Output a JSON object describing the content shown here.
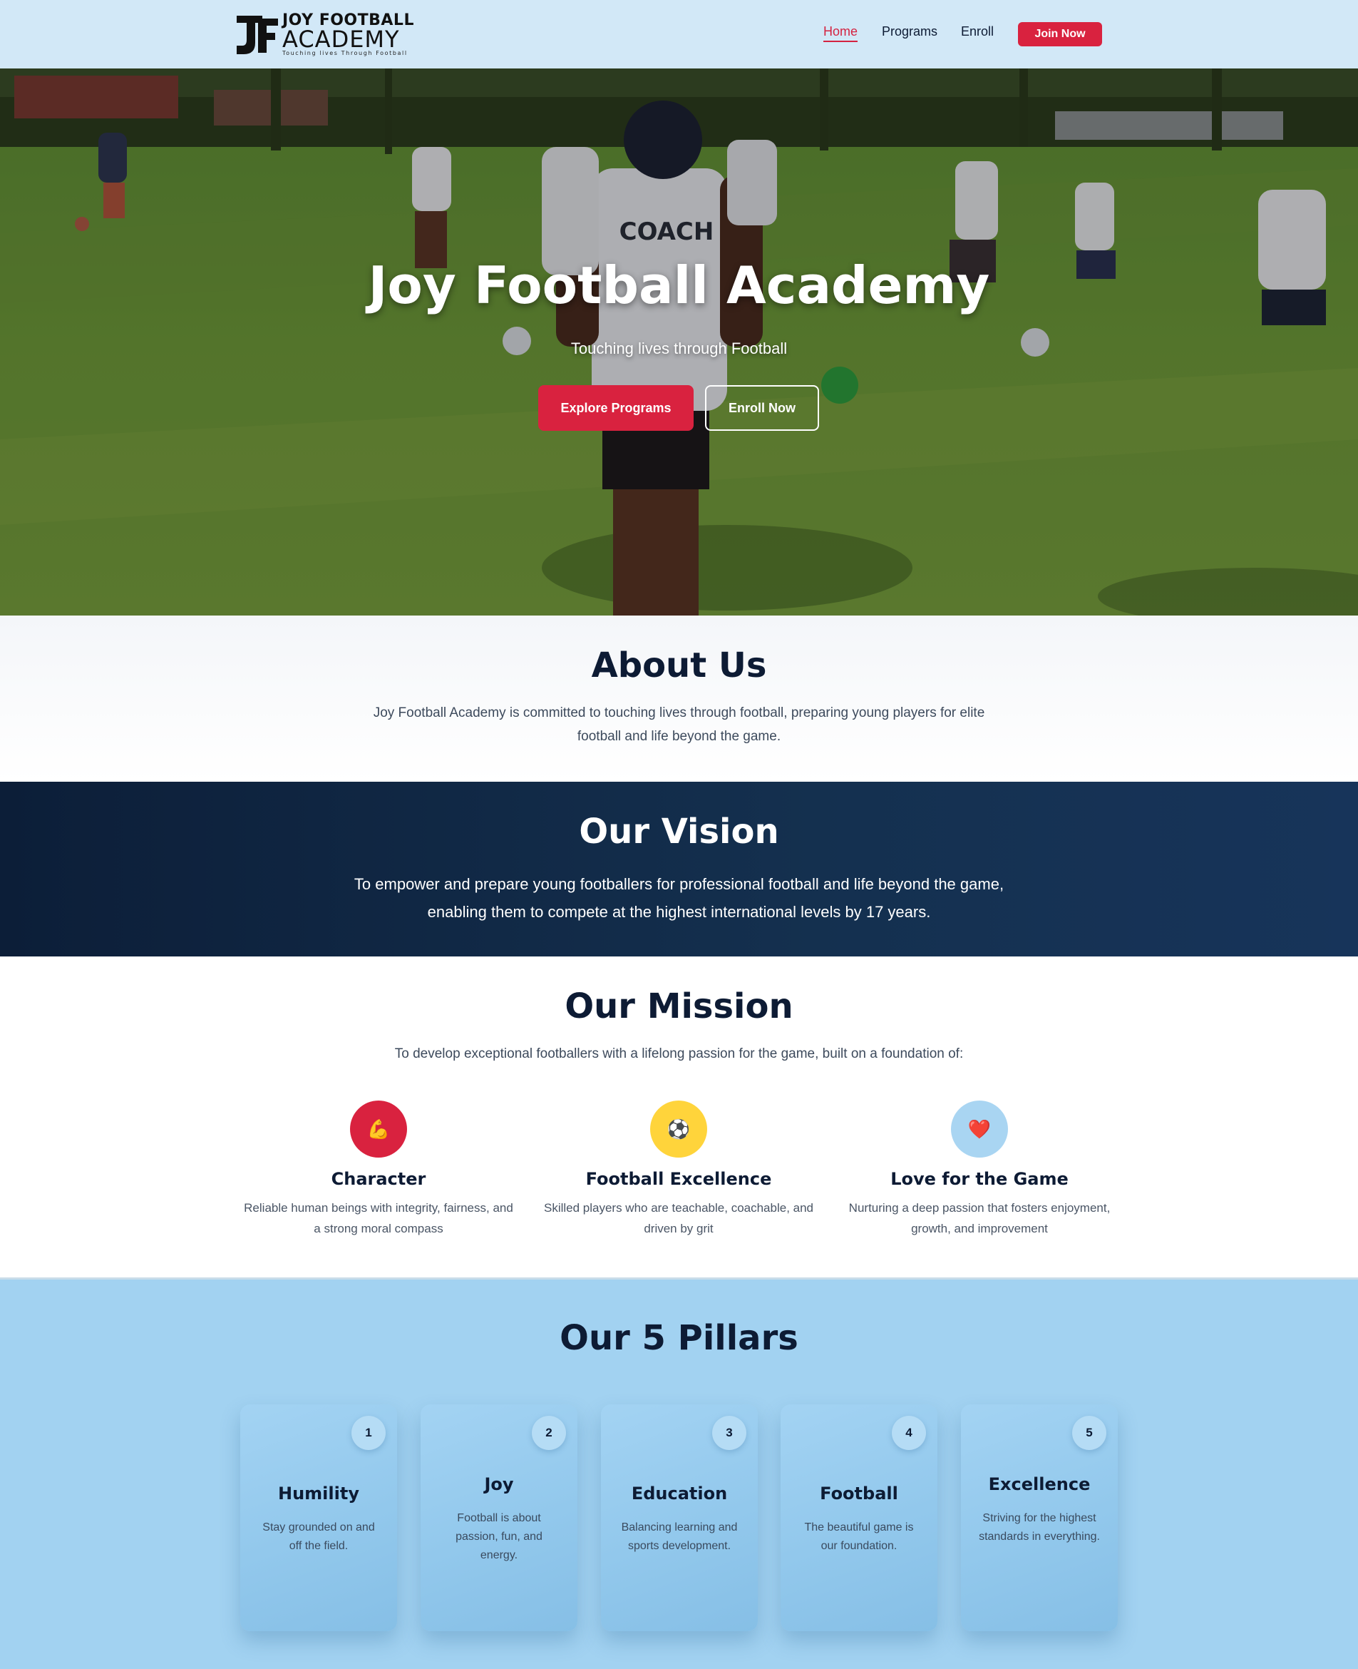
{
  "nav": {
    "logo": {
      "line1": "JOY FOOTBALL",
      "line2": "ACADEMY",
      "tagline": "Touching lives Through Football"
    },
    "links": [
      {
        "label": "Home",
        "active": true
      },
      {
        "label": "Programs",
        "active": false
      },
      {
        "label": "Enroll",
        "active": false
      }
    ],
    "cta": "Join Now"
  },
  "hero": {
    "title": "Joy Football Academy",
    "subtitle": "Touching lives through Football",
    "primary_button": "Explore Programs",
    "secondary_button": "Enroll Now",
    "shirt_text": "COACH"
  },
  "about": {
    "title": "About Us",
    "text": "Joy Football Academy is committed to touching lives through football, preparing young players for elite football and life beyond the game."
  },
  "vision": {
    "title": "Our Vision",
    "text": "To empower and prepare young footballers for professional football and life beyond the game, enabling them to compete at the highest international levels by 17 years."
  },
  "mission": {
    "title": "Our Mission",
    "text": "To develop exceptional footballers with a lifelong passion for the game, built on a foundation of:",
    "features": [
      {
        "icon": "💪",
        "icon_name": "flexed-biceps-icon",
        "color": "#d9223f",
        "title": "Character",
        "desc": "Reliable human beings with integrity, fairness, and a strong moral compass"
      },
      {
        "icon": "⚽",
        "icon_name": "soccer-ball-icon",
        "color": "#ffd43b",
        "title": "Football Excellence",
        "desc": "Skilled players who are teachable, coachable, and driven by grit"
      },
      {
        "icon": "❤️",
        "icon_name": "heart-icon",
        "color": "#a9d5f2",
        "title": "Love for the Game",
        "desc": "Nurturing a deep passion that fosters enjoyment, growth, and improvement"
      }
    ]
  },
  "pillars": {
    "title": "Our 5 Pillars",
    "items": [
      {
        "num": "1",
        "title": "Humility",
        "desc": "Stay grounded on and off the field."
      },
      {
        "num": "2",
        "title": "Joy",
        "desc": "Football is about passion, fun, and energy."
      },
      {
        "num": "3",
        "title": "Education",
        "desc": "Balancing learning and sports development."
      },
      {
        "num": "4",
        "title": "Football",
        "desc": "The beautiful game is our foundation."
      },
      {
        "num": "5",
        "title": "Excellence",
        "desc": "Striving for the highest standards in everything."
      }
    ]
  }
}
